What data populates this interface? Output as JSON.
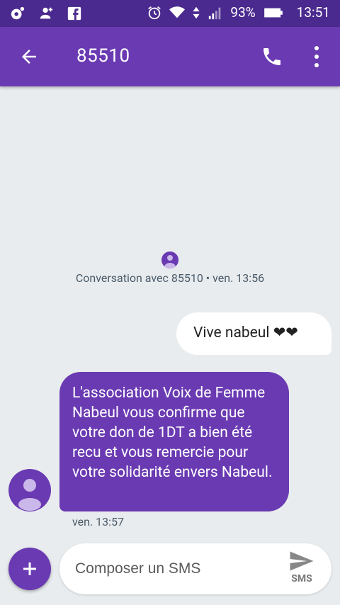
{
  "status_bar": {
    "battery": "93%",
    "time": "13:51",
    "icons": [
      "notification-icon",
      "person-add-icon",
      "facebook-icon",
      "alarm-icon",
      "wifi-icon",
      "data-arrows-icon",
      "signal-icon",
      "battery-icon"
    ]
  },
  "app_bar": {
    "title": "85510",
    "icons": [
      "back-arrow-icon",
      "phone-icon",
      "more-vert-icon"
    ]
  },
  "conversation": {
    "info": "Conversation avec 85510 • ven. 13:56",
    "messages": [
      {
        "direction": "outgoing",
        "text": "Vive nabeul ❤❤"
      },
      {
        "direction": "incoming",
        "text": "L'association Voix de Femme Nabeul vous confirme que votre don de 1DT a bien été recu et vous remercie pour votre solidarité envers Nabeul.",
        "time": "ven. 13:57"
      }
    ]
  },
  "composer": {
    "placeholder": "Composer un SMS",
    "send_label": "SMS"
  },
  "colors": {
    "status_bar": "#4a2a8f",
    "accent": "#6a3ab2",
    "background": "#e8ecee",
    "bubble_out": "#ffffff"
  }
}
